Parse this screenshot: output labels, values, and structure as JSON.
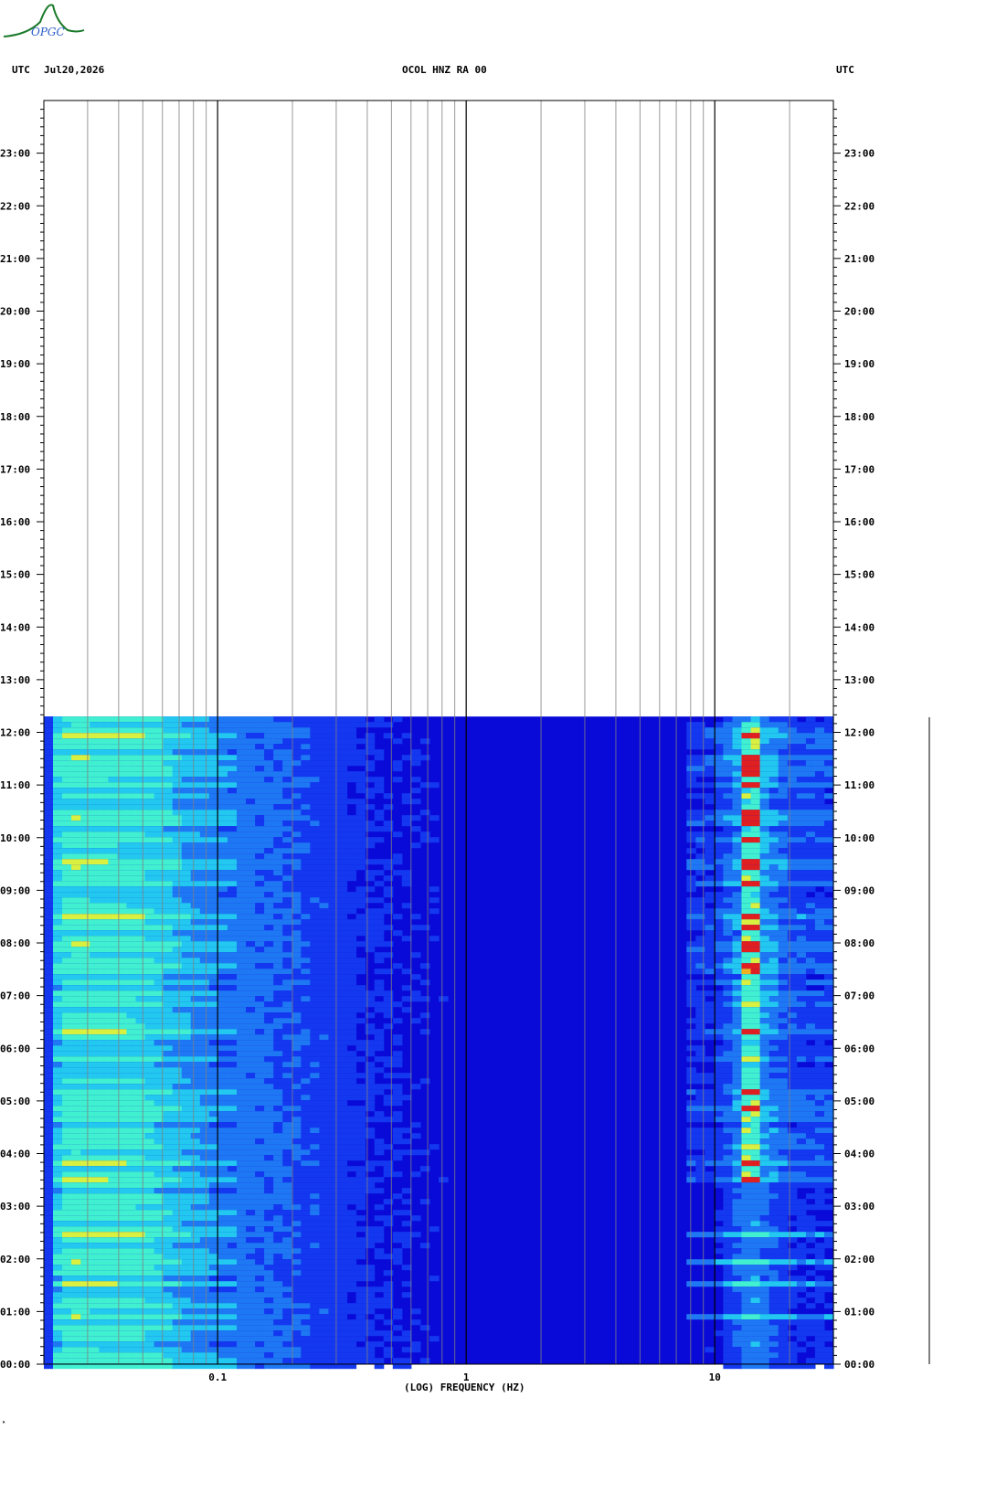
{
  "logo": {
    "text": "OPGC",
    "color": "#1a7a2a",
    "text_color": "#2a5cc8"
  },
  "header": {
    "left_utc": "UTC",
    "date": "Jul20,2026",
    "title": "OCOL HNZ RA 00",
    "right_utc": "UTC"
  },
  "chart_data": {
    "type": "heatmap",
    "title": "OCOL HNZ RA 00",
    "xlabel": "(LOG) FREQUENCY (HZ)",
    "x_scale": "log",
    "xlim": [
      0.02,
      30
    ],
    "x_ticks": [
      {
        "value": 0.1,
        "label": "0.1"
      },
      {
        "value": 1,
        "label": "1"
      },
      {
        "value": 10,
        "label": "10"
      }
    ],
    "ylim": [
      0,
      24
    ],
    "y_tick_labels": [
      "00:00",
      "01:00",
      "02:00",
      "03:00",
      "04:00",
      "05:00",
      "06:00",
      "07:00",
      "08:00",
      "09:00",
      "10:00",
      "11:00",
      "12:00",
      "13:00",
      "14:00",
      "15:00",
      "16:00",
      "17:00",
      "18:00",
      "19:00",
      "20:00",
      "21:00",
      "22:00",
      "23:00"
    ],
    "data_end_hour": 12.3,
    "colormap": [
      "#0a0ad8",
      "#1438f0",
      "#1e78f4",
      "#22c8f0",
      "#40f0d0",
      "#d8f040",
      "#f0b020",
      "#e02020"
    ],
    "spectrum_profile": [
      {
        "freq": 0.02,
        "level": 0.35
      },
      {
        "freq": 0.025,
        "level": 0.55
      },
      {
        "freq": 0.05,
        "level": 0.52
      },
      {
        "freq": 0.07,
        "level": 0.42
      },
      {
        "freq": 0.1,
        "level": 0.33
      },
      {
        "freq": 0.2,
        "level": 0.25
      },
      {
        "freq": 0.4,
        "level": 0.14
      },
      {
        "freq": 1,
        "level": 0.06
      },
      {
        "freq": 5,
        "level": 0.04
      },
      {
        "freq": 10,
        "level": 0.08
      },
      {
        "freq": 14,
        "level": 0.35
      },
      {
        "freq": 20,
        "level": 0.15
      },
      {
        "freq": 30,
        "level": 0.12
      }
    ],
    "hot_band_freq": 14,
    "active_hours": [
      3.5,
      12.3
    ]
  }
}
